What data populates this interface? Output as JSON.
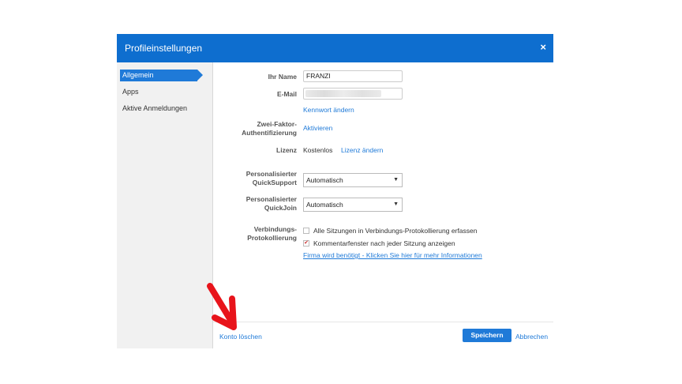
{
  "dialog": {
    "title": "Profileinstellungen",
    "close_symbol": "×",
    "accent_color": "#0e6ecf"
  },
  "sidebar": {
    "items": [
      {
        "label": "Allgemein",
        "active": true
      },
      {
        "label": "Apps",
        "active": false
      },
      {
        "label": "Aktive Anmeldungen",
        "active": false
      }
    ]
  },
  "form": {
    "name_label": "Ihr Name",
    "name_value": "FRANZI",
    "email_label": "E-Mail",
    "change_password_link": "Kennwort ändern",
    "twofactor_label_line1": "Zwei-Faktor-",
    "twofactor_label_line2": "Authentifizierung",
    "twofactor_link": "Aktivieren",
    "license_label": "Lizenz",
    "license_value": "Kostenlos",
    "license_link": "Lizenz ändern",
    "quicksupport_label_line1": "Personalisierter",
    "quicksupport_label_line2": "QuickSupport",
    "quicksupport_value": "Automatisch",
    "quickjoin_label_line1": "Personalisierter",
    "quickjoin_label_line2": "QuickJoin",
    "quickjoin_value": "Automatisch",
    "log_label_line1": "Verbindungs-",
    "log_label_line2": "Protokollierung",
    "log_checkbox1_label": "Alle Sitzungen in Verbindungs-Protokollierung erfassen",
    "log_checkbox1_checked": false,
    "log_checkbox2_label": "Kommentarfenster nach jeder Sitzung anzeigen",
    "log_checkbox2_checked": true,
    "company_required_link": "Firma wird benötigt - Klicken Sie hier für mehr Informationen"
  },
  "footer": {
    "delete_account_link": "Konto löschen",
    "save_button": "Speichern",
    "cancel_link": "Abbrechen"
  },
  "annotation": {
    "arrow_color": "#e8141b"
  }
}
